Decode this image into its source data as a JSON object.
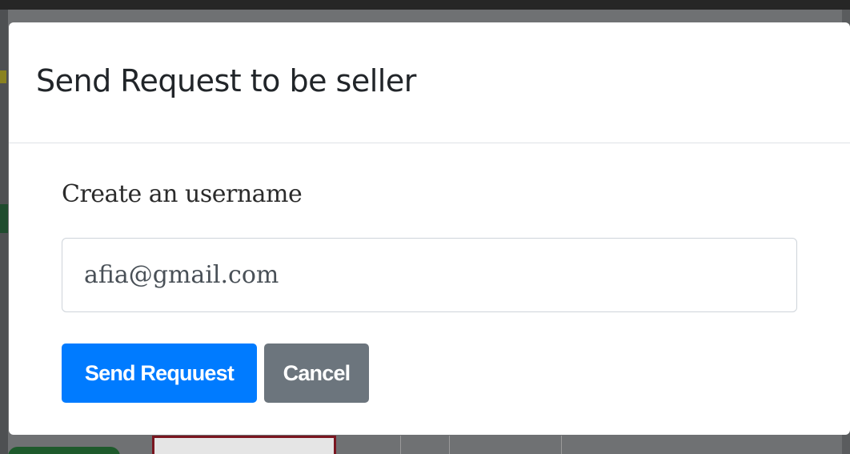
{
  "modal": {
    "title": "Send Request to be seller",
    "field_label": "Create an username",
    "username_value": "afia@gmail.com",
    "send_button_label": "Send Requuest",
    "cancel_button_label": "Cancel"
  },
  "colors": {
    "primary": "#007bff",
    "secondary": "#6c757d",
    "backdrop": "#6f7173"
  }
}
